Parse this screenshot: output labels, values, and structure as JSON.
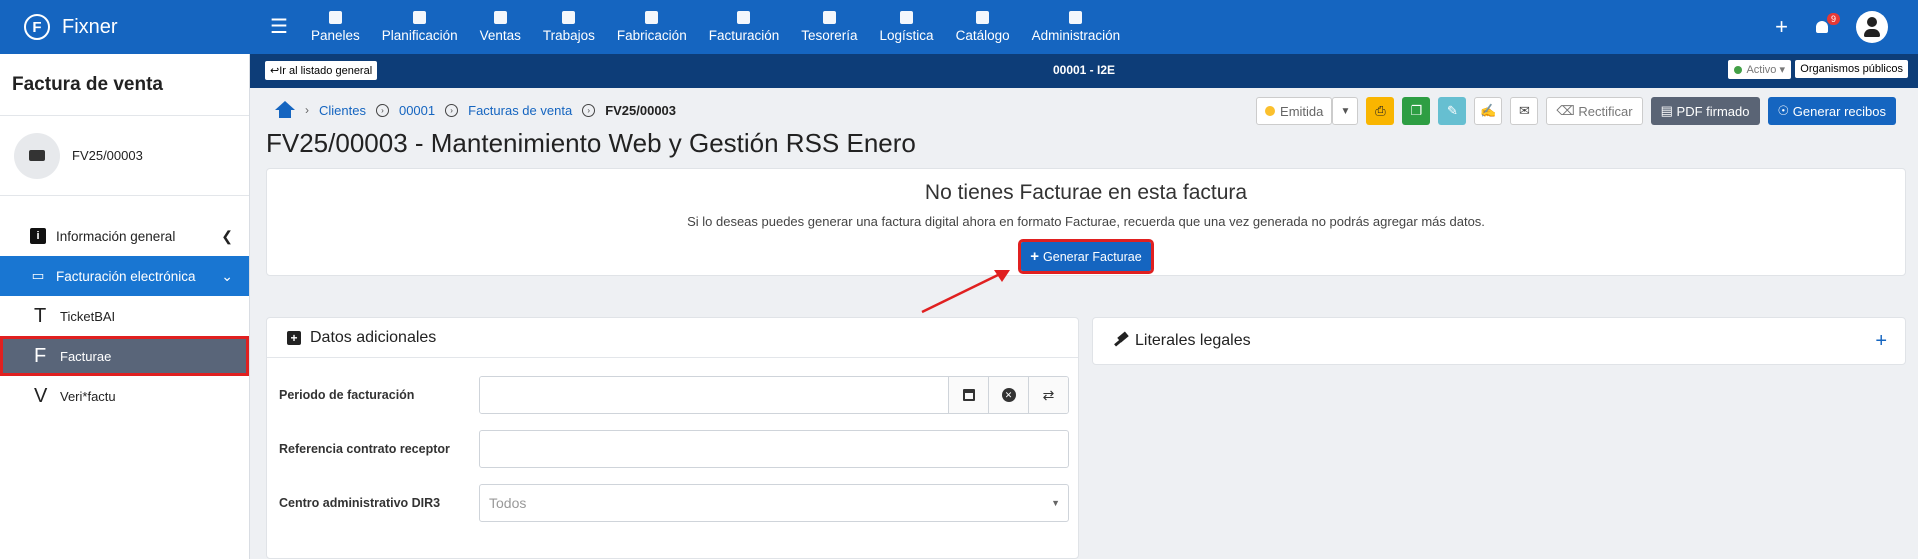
{
  "app": {
    "name": "Fixner",
    "logo_letter": "F"
  },
  "nav": [
    {
      "label": "Paneles",
      "icon": "panels-icon"
    },
    {
      "label": "Planificación",
      "icon": "calendar-icon"
    },
    {
      "label": "Ventas",
      "icon": "handshake-icon"
    },
    {
      "label": "Trabajos",
      "icon": "folder-icon"
    },
    {
      "label": "Fabricación",
      "icon": "factory-icon"
    },
    {
      "label": "Facturación",
      "icon": "invoice-icon"
    },
    {
      "label": "Tesorería",
      "icon": "money-icon"
    },
    {
      "label": "Logística",
      "icon": "logistics-icon"
    },
    {
      "label": "Catálogo",
      "icon": "catalog-icon"
    },
    {
      "label": "Administración",
      "icon": "gear-icon"
    }
  ],
  "topright": {
    "notifications": "9"
  },
  "sidebar": {
    "title": "Factura de venta",
    "doc_label": "FV25/00003",
    "items": [
      {
        "label": "Información general"
      },
      {
        "label": "Facturación electrónica"
      }
    ],
    "subitems": [
      {
        "letter": "T",
        "label": "TicketBAI"
      },
      {
        "letter": "F",
        "label": "Facturae"
      },
      {
        "letter": "V",
        "label": "Veri*factu"
      }
    ]
  },
  "titlebar": {
    "back_label": "Ir al listado general",
    "code": "00001 - I2E",
    "status": "Activo",
    "org_label": "Organismos públicos"
  },
  "breadcrumb": [
    "Clientes",
    "00001",
    "Facturas de venta",
    "FV25/00003"
  ],
  "page_title": "FV25/00003 - Mantenimiento Web y Gestión RSS Enero",
  "actions": {
    "status": "Emitida",
    "rectificar": "Rectificar",
    "pdf": "PDF firmado",
    "recibos": "Generar recibos"
  },
  "facturae": {
    "title": "No tienes Facturae en esta factura",
    "description": "Si lo deseas puedes generar una factura digital ahora en formato Facturae, recuerda que una vez generada no podrás agregar más datos.",
    "button": "Generar Facturae"
  },
  "datos": {
    "title": "Datos adicionales",
    "periodo_label": "Periodo de facturación",
    "periodo_value": "",
    "referencia_label": "Referencia contrato receptor",
    "referencia_value": "",
    "dir3_label": "Centro administrativo DIR3",
    "dir3_value": "Todos"
  },
  "literales": {
    "title": "Literales legales"
  },
  "colors": {
    "primary": "#1565c0",
    "dark_bar": "#0d3d78",
    "highlight": "#e02020"
  }
}
